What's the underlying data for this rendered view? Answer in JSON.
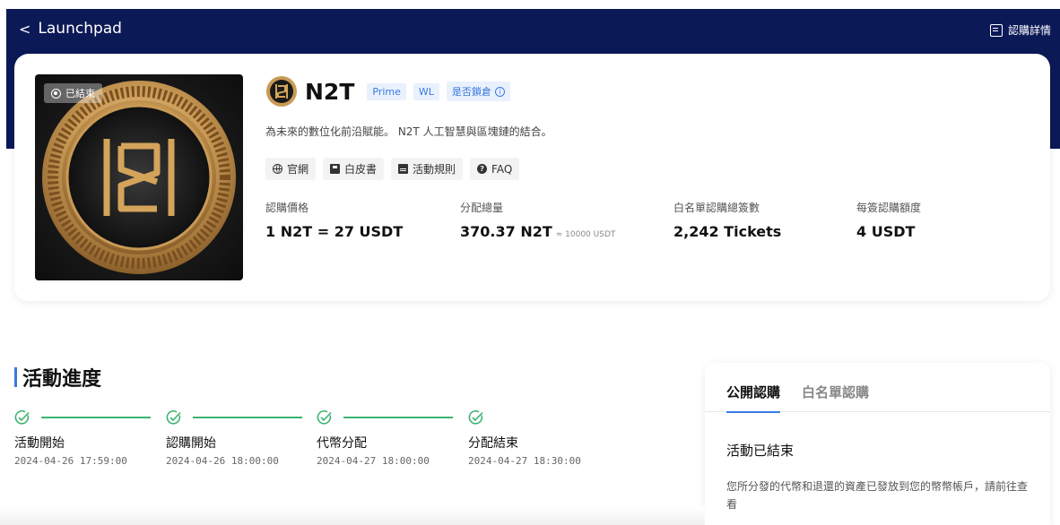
{
  "header": {
    "back_label": "Launchpad",
    "details_label": "認購詳情"
  },
  "project": {
    "status_badge": "已結束",
    "token_name": "N2T",
    "tags": [
      "Prime",
      "WL"
    ],
    "lock_tag": "是否鎖倉",
    "description": "為未來的數位化前沿賦能。 N2T 人工智慧與區塊鏈的結合。",
    "links": [
      {
        "icon": "globe-icon",
        "label": "官網"
      },
      {
        "icon": "whitepaper-icon",
        "label": "白皮書"
      },
      {
        "icon": "document-icon",
        "label": "活動規則"
      },
      {
        "icon": "faq-icon",
        "label": "FAQ"
      }
    ],
    "stats": [
      {
        "label": "認購價格",
        "value": "1 N2T = 27 USDT",
        "sub": ""
      },
      {
        "label": "分配總量",
        "value": "370.37 N2T",
        "sub": "≈ 10000 USDT"
      },
      {
        "label": "白名單認購總簽數",
        "value": "2,242 Tickets",
        "sub": ""
      },
      {
        "label": "每簽認購額度",
        "value": "4 USDT",
        "sub": ""
      }
    ]
  },
  "progress": {
    "title": "活動進度",
    "steps": [
      {
        "label": "活動開始",
        "time": "2024-04-26 17:59:00"
      },
      {
        "label": "認購開始",
        "time": "2024-04-26 18:00:00"
      },
      {
        "label": "代幣分配",
        "time": "2024-04-27 18:00:00"
      },
      {
        "label": "分配結束",
        "time": "2024-04-27 18:30:00"
      }
    ]
  },
  "subscription": {
    "tabs": [
      "公開認購",
      "白名單認購"
    ],
    "status": "活動已結束",
    "note": "您所分發的代幣和退還的資產已發放到您的幣幣帳戶，請前往查看"
  },
  "colors": {
    "header_bg": "#0c1957",
    "accent": "#3a79e0",
    "success": "#3cb371",
    "gold": "#d4a45a"
  }
}
